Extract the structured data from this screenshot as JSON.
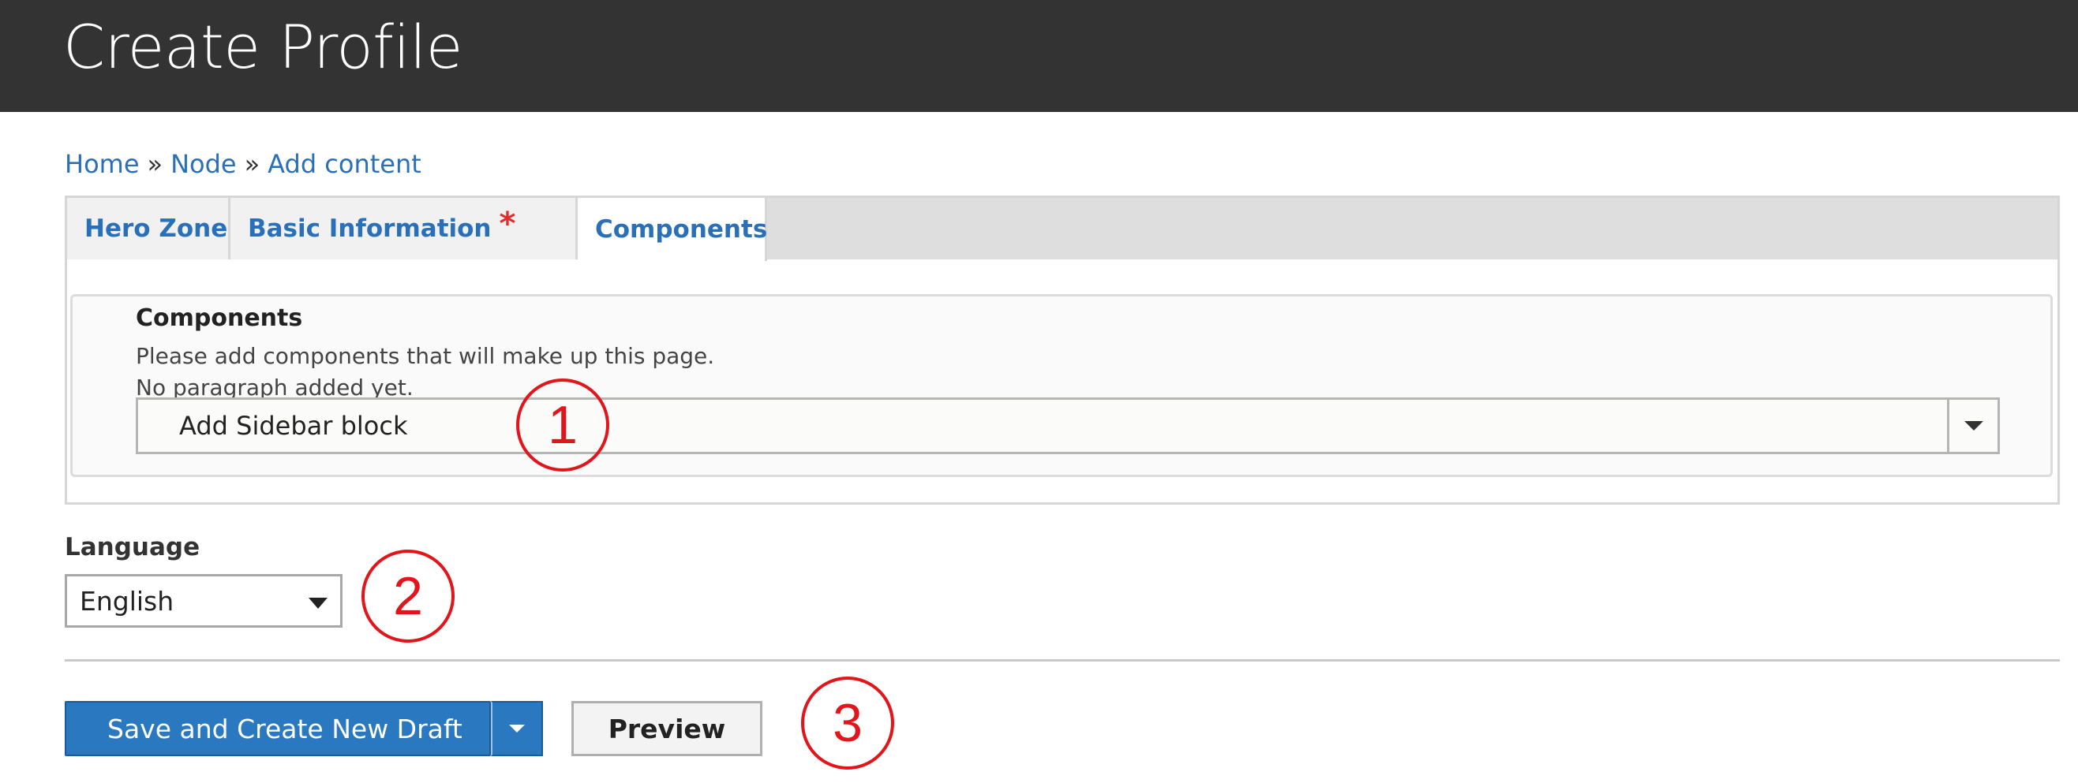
{
  "header": {
    "title": "Create Profile"
  },
  "breadcrumb": {
    "home": "Home",
    "node": "Node",
    "add_content": "Add content",
    "separator": "»"
  },
  "tabs": {
    "hero": "Hero Zone",
    "basic": "Basic Information",
    "basic_required": "*",
    "components": "Components"
  },
  "components": {
    "title": "Components",
    "description": "Please add components that will make up this page.",
    "empty_text": "No paragraph added yet.",
    "add_select_value": "Add Sidebar block"
  },
  "language": {
    "label": "Language",
    "value": "English"
  },
  "actions": {
    "save_label": "Save and Create New Draft",
    "preview_label": "Preview"
  },
  "annotations": {
    "one": "1",
    "two": "2",
    "three": "3"
  },
  "colors": {
    "header_bg": "#333333",
    "link": "#2a70b8",
    "primary_button": "#2a78c0",
    "marker": "#e2151b"
  }
}
